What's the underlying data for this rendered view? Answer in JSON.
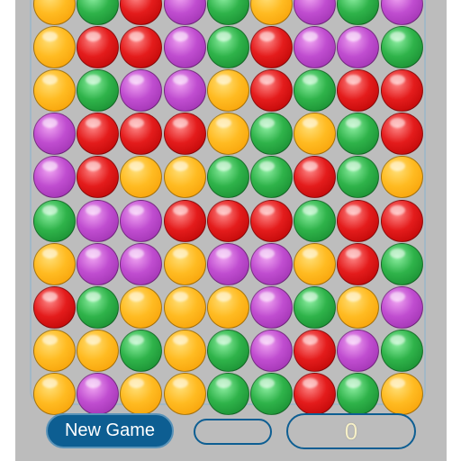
{
  "controls": {
    "new_game_label": "New Game",
    "status_text": "",
    "score": "0"
  },
  "colors": {
    "panel": "#bcbcbc",
    "button": "#0d5e92",
    "orange": "#ffbb22",
    "red": "#e41c1c",
    "green": "#2fb34a",
    "purple": "#c04dd0"
  },
  "board": {
    "columns": 9,
    "grid": [
      [
        "orange",
        "green",
        "red",
        "purple",
        "green",
        "orange",
        "purple",
        "green",
        "purple"
      ],
      [
        "orange",
        "red",
        "red",
        "purple",
        "green",
        "red",
        "purple",
        "purple",
        "green"
      ],
      [
        "orange",
        "green",
        "purple",
        "purple",
        "orange",
        "red",
        "green",
        "red",
        "red"
      ],
      [
        "purple",
        "red",
        "red",
        "red",
        "orange",
        "green",
        "orange",
        "green",
        "red"
      ],
      [
        "purple",
        "red",
        "orange",
        "orange",
        "green",
        "green",
        "red",
        "green",
        "orange"
      ],
      [
        "green",
        "purple",
        "purple",
        "red",
        "red",
        "red",
        "green",
        "red",
        "red"
      ],
      [
        "orange",
        "purple",
        "purple",
        "orange",
        "purple",
        "purple",
        "orange",
        "red",
        "green"
      ],
      [
        "red",
        "green",
        "orange",
        "orange",
        "orange",
        "purple",
        "green",
        "orange",
        "purple"
      ],
      [
        "orange",
        "orange",
        "green",
        "orange",
        "green",
        "purple",
        "red",
        "purple",
        "green"
      ],
      [
        "orange",
        "purple",
        "orange",
        "orange",
        "green",
        "green",
        "red",
        "green",
        "orange"
      ]
    ]
  }
}
